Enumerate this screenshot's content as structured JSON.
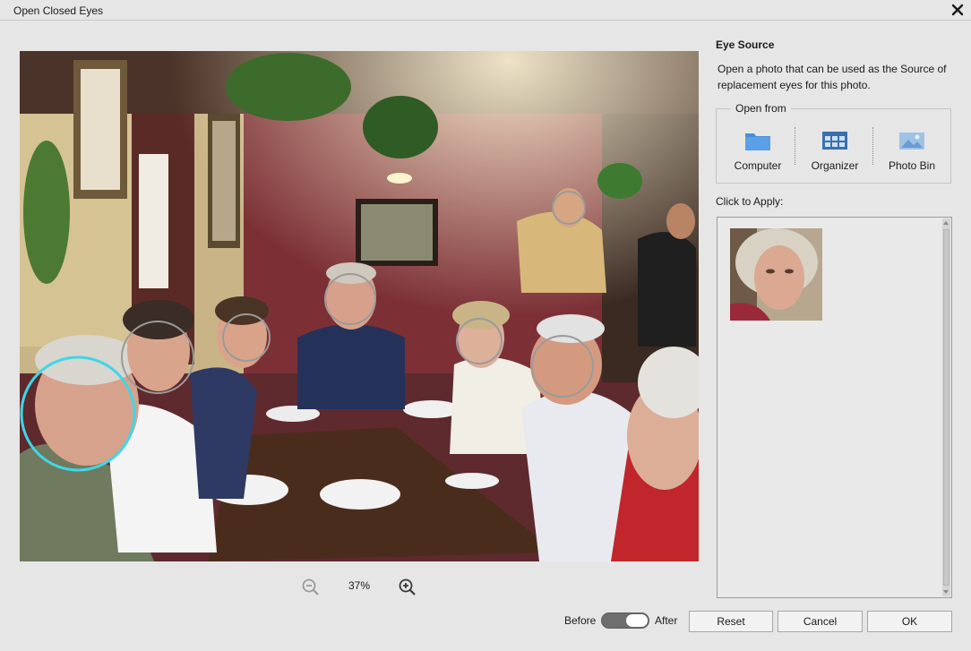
{
  "window": {
    "title": "Open Closed Eyes",
    "close_icon": "close-icon"
  },
  "photo": {
    "description_icon": "photo-image"
  },
  "zoom": {
    "level": "37%",
    "zoom_out_icon": "zoom-out-icon",
    "zoom_in_icon": "zoom-in-icon"
  },
  "panel": {
    "title": "Eye Source",
    "description": "Open a photo that can be used as the Source of replacement eyes for this photo.",
    "open_from": {
      "legend": "Open from",
      "sources": [
        {
          "label": "Computer",
          "icon": "folder-icon"
        },
        {
          "label": "Organizer",
          "icon": "organizer-grid-icon"
        },
        {
          "label": "Photo Bin",
          "icon": "photo-bin-icon"
        }
      ]
    },
    "click_to_apply": "Click to Apply:"
  },
  "footer": {
    "before_label": "Before",
    "after_label": "After",
    "toggle_state": "after",
    "buttons": {
      "reset": "Reset",
      "cancel": "Cancel",
      "ok": "OK"
    }
  },
  "colors": {
    "selected_face_ring": "#3fd6e6",
    "face_ring": "#9a9a9a",
    "wall": "#7a2f36"
  }
}
